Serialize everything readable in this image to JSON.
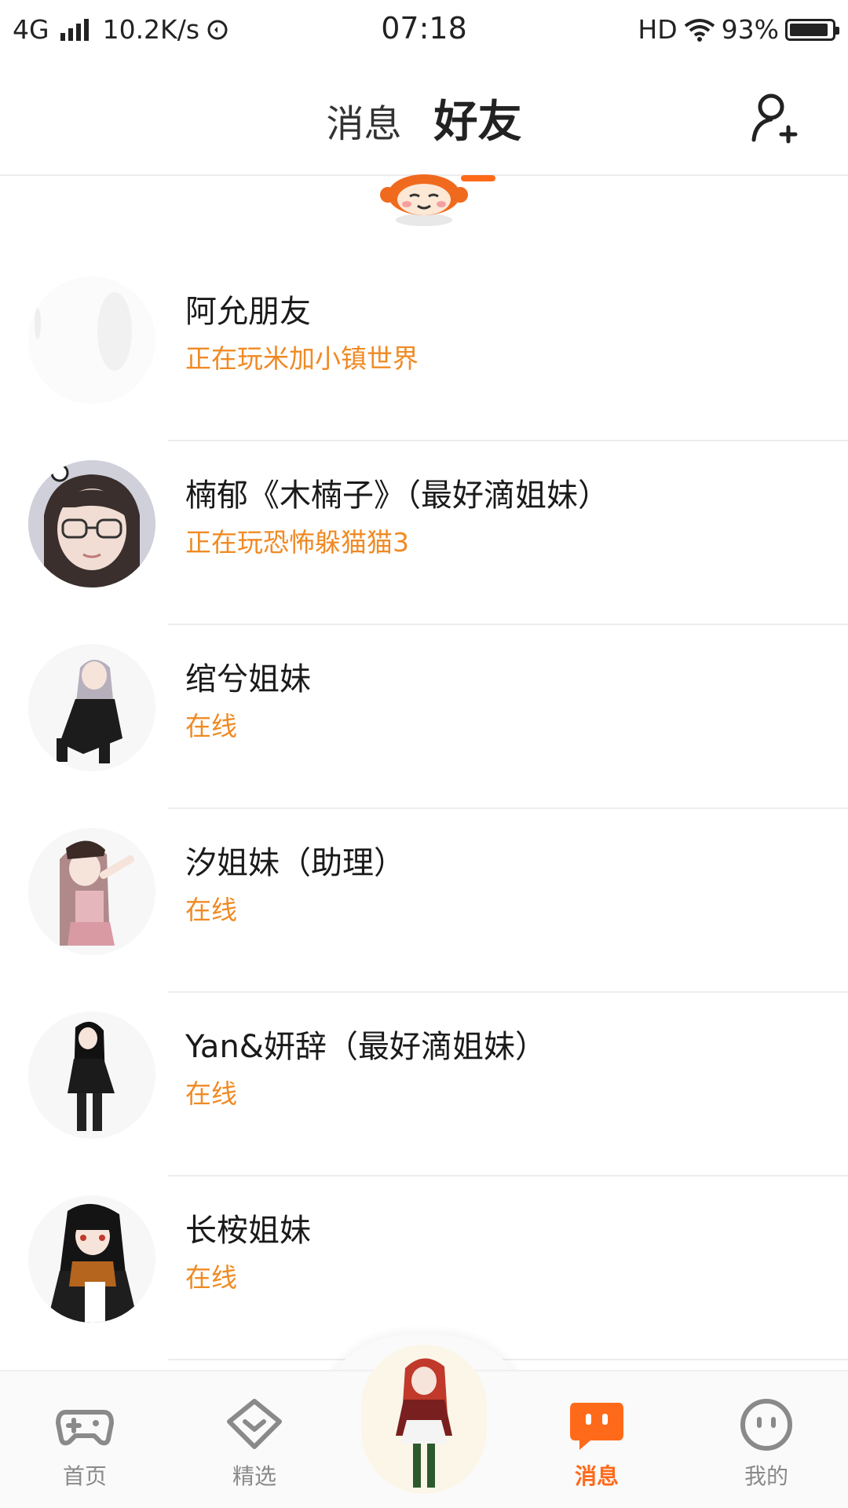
{
  "status_bar": {
    "network": "4G",
    "speed": "10.2K/s",
    "time": "07:18",
    "hd": "HD",
    "battery": "93%",
    "battery_level": 0.93
  },
  "header": {
    "tabs": [
      {
        "label": "消息",
        "active": false
      },
      {
        "label": "好友",
        "active": true
      }
    ],
    "add_friend_icon": "add-user-icon"
  },
  "friends": [
    {
      "name": "阿允朋友",
      "status": "正在玩米加小镇世界",
      "avatar": "avatar-faded"
    },
    {
      "name": "楠郁《木楠子》（最好滴姐妹）",
      "status": "正在玩恐怖躲猫猫3",
      "avatar": "avatar-photo-glasses"
    },
    {
      "name": "绾兮姐妹",
      "status": "在线",
      "avatar": "avatar-anime-gray-hair"
    },
    {
      "name": "汐姐妹（助理）",
      "status": "在线",
      "avatar": "avatar-anime-pink-hair"
    },
    {
      "name": "Yan&妍辞（最好滴姐妹）",
      "status": "在线",
      "avatar": "avatar-anime-black-dress"
    },
    {
      "name": "长桉姐妹",
      "status": "在线",
      "avatar": "avatar-anime-scarf"
    }
  ],
  "bottom_nav": [
    {
      "label": "首页",
      "icon": "gamepad-icon",
      "active": false
    },
    {
      "label": "精选",
      "icon": "heart-chat-icon",
      "active": false
    },
    {
      "label": "消息",
      "icon": "message-icon",
      "active": true
    },
    {
      "label": "我的",
      "icon": "smiley-icon",
      "active": false
    }
  ],
  "colors": {
    "accent": "#ff6a1a",
    "status_orange": "#f08a24",
    "nav_gray": "#8a8a8a"
  }
}
